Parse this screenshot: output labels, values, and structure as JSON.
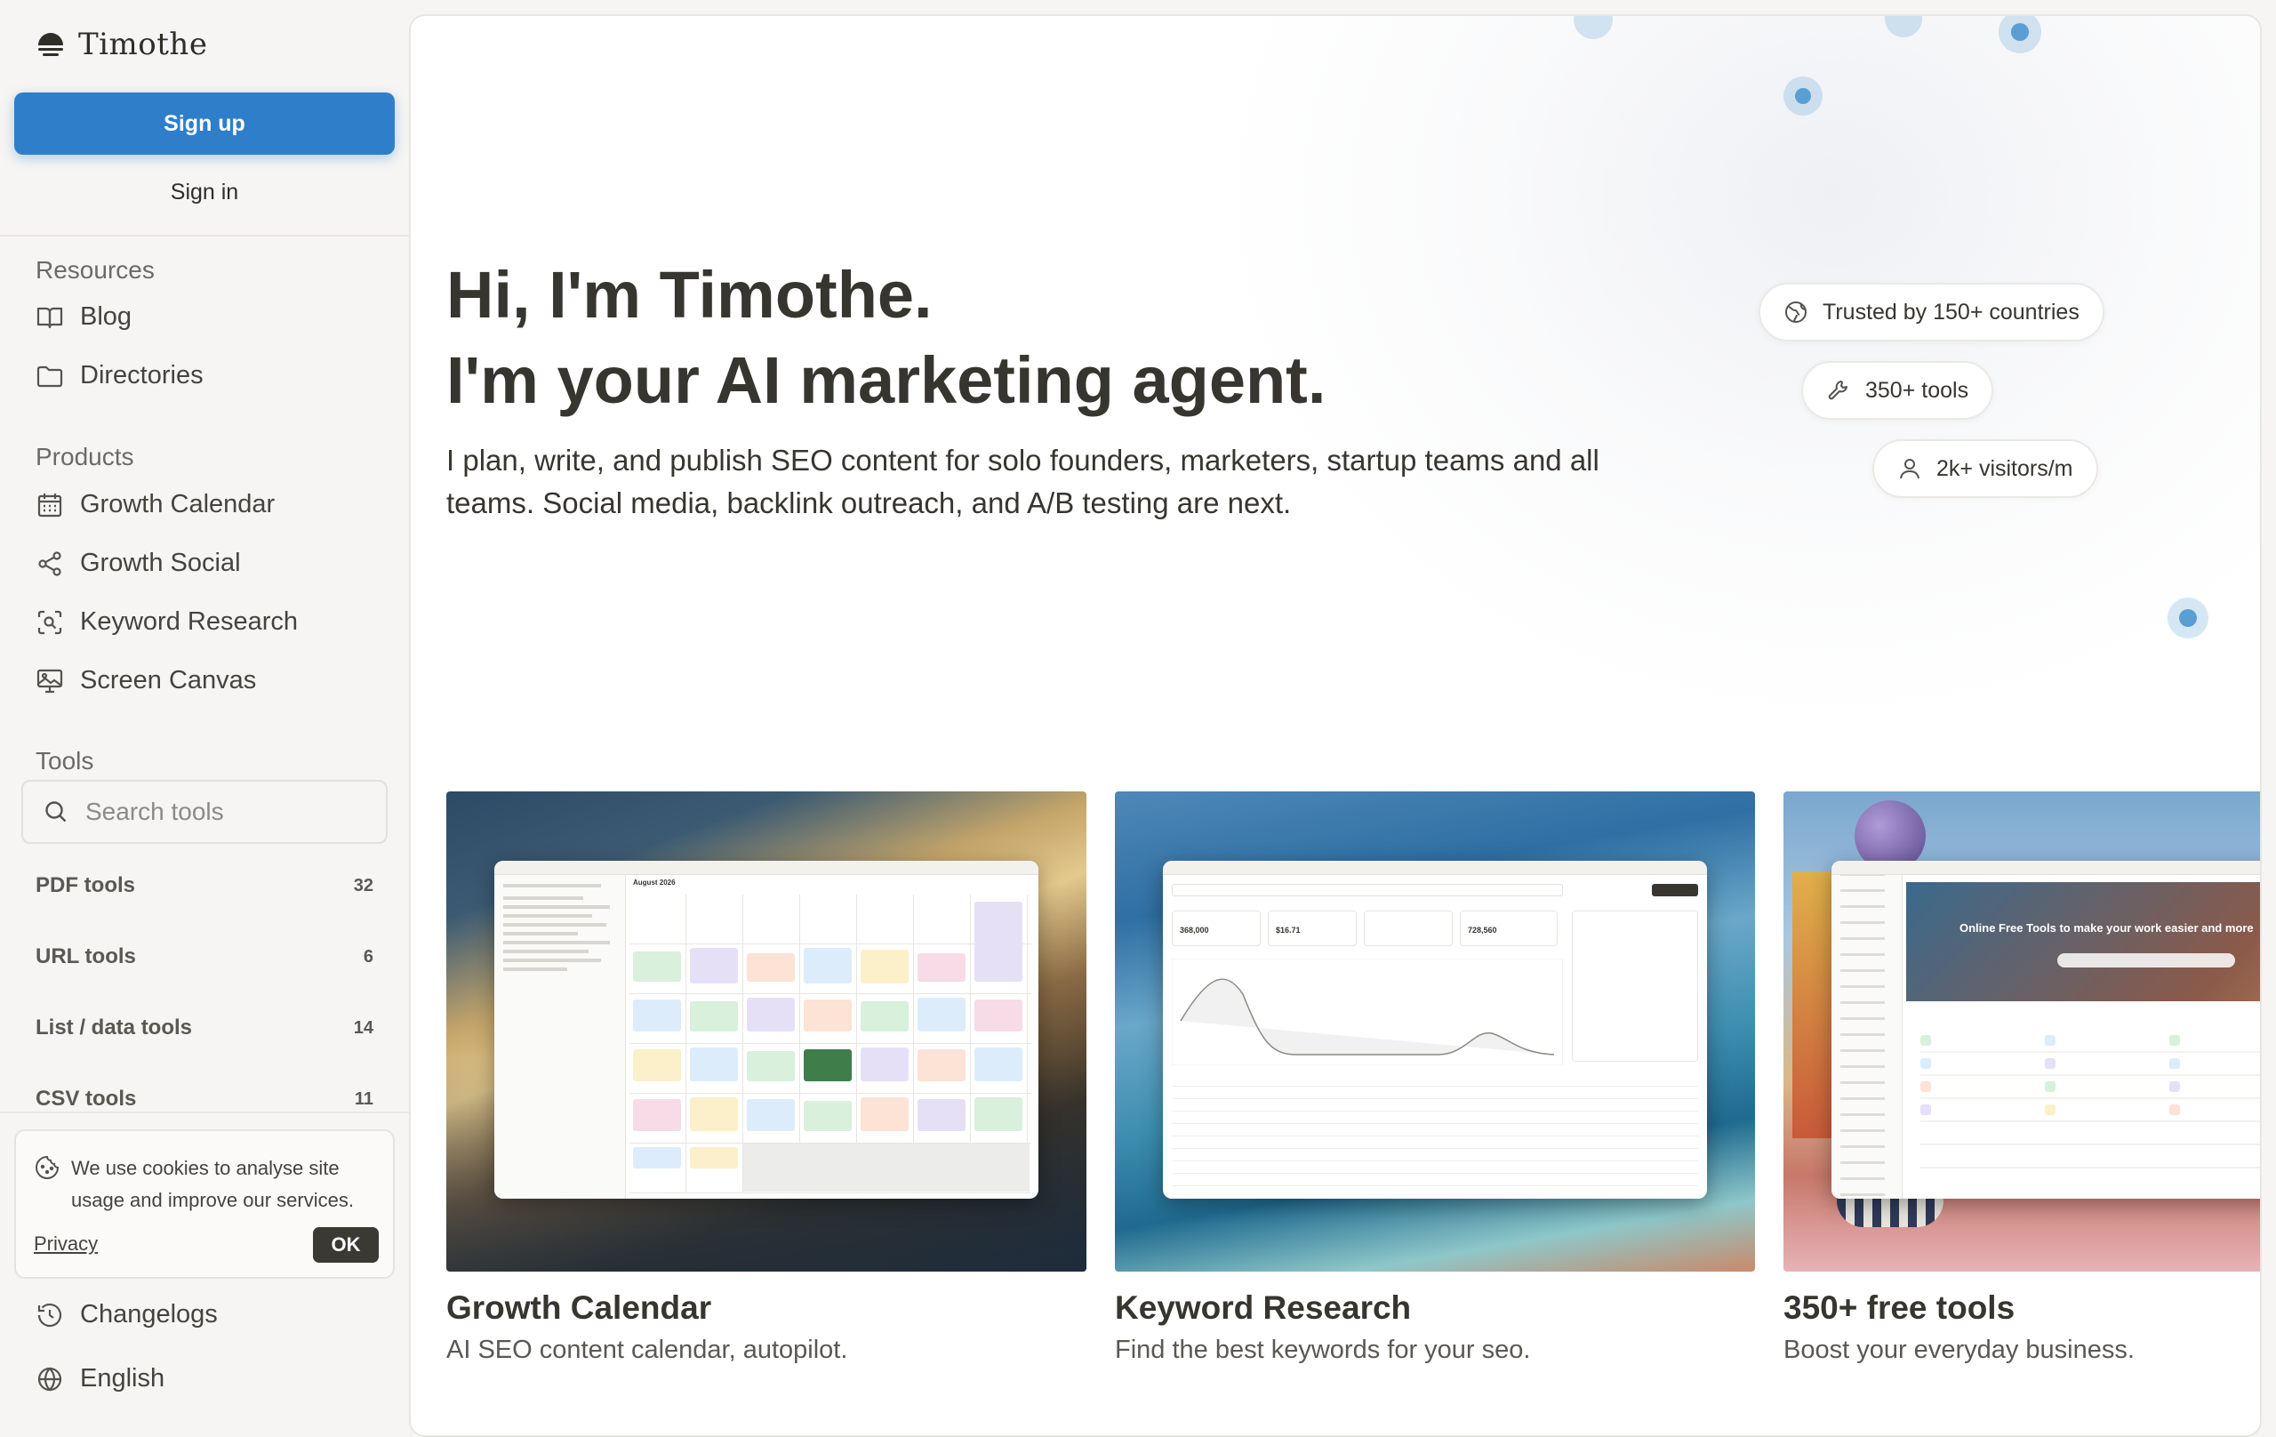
{
  "brand": {
    "name": "Timothe"
  },
  "auth": {
    "signup_label": "Sign up",
    "signin_label": "Sign in"
  },
  "sidebar": {
    "resources": {
      "heading": "Resources",
      "items": [
        {
          "label": "Blog",
          "icon": "book-icon"
        },
        {
          "label": "Directories",
          "icon": "folder-icon"
        }
      ]
    },
    "products": {
      "heading": "Products",
      "items": [
        {
          "label": "Growth Calendar",
          "icon": "calendar-icon"
        },
        {
          "label": "Growth Social",
          "icon": "share-icon"
        },
        {
          "label": "Keyword Research",
          "icon": "scan-search-icon"
        },
        {
          "label": "Screen Canvas",
          "icon": "monitor-image-icon"
        }
      ]
    },
    "tools": {
      "heading": "Tools",
      "search_placeholder": "Search tools",
      "categories": [
        {
          "label": "PDF tools",
          "count": "32"
        },
        {
          "label": "URL tools",
          "count": "6"
        },
        {
          "label": "List / data tools",
          "count": "14"
        },
        {
          "label": "CSV tools",
          "count": "11"
        }
      ]
    },
    "footer": {
      "changelogs": "Changelogs",
      "language": "English"
    }
  },
  "cookie_banner": {
    "text": "We use cookies to analyse site usage and improve our services.",
    "privacy_label": "Privacy",
    "ok_label": "OK"
  },
  "hero": {
    "title_line1": "Hi, I'm Timothe.",
    "title_line2": "I'm your AI marketing agent.",
    "subtitle": "I plan, write, and publish SEO content for solo founders, marketers, startup teams and all teams. Social media, backlink outreach, and A/B testing are next."
  },
  "stats": [
    {
      "label": "Trusted by 150+ countries",
      "icon": "globe-icon"
    },
    {
      "label": "350+ tools",
      "icon": "wrench-icon"
    },
    {
      "label": "2k+ visitors/m",
      "icon": "user-icon"
    }
  ],
  "cards": [
    {
      "title": "Growth Calendar",
      "description": "AI SEO content calendar, autopilot."
    },
    {
      "title": "Keyword Research",
      "description": "Find the best keywords for your seo."
    },
    {
      "title": "350+ free tools",
      "description": "Boost your everyday business."
    }
  ],
  "card_previews": {
    "calendar_month": "August 2026",
    "kw_volume": "368,000",
    "kw_cpc": "$16.71",
    "kw_total": "728,560",
    "tools_banner": "Online Free Tools to make your work easier and more"
  },
  "colors": {
    "accent": "#2f7ec9",
    "dot": "#5a9ed3",
    "text": "#37352f"
  }
}
